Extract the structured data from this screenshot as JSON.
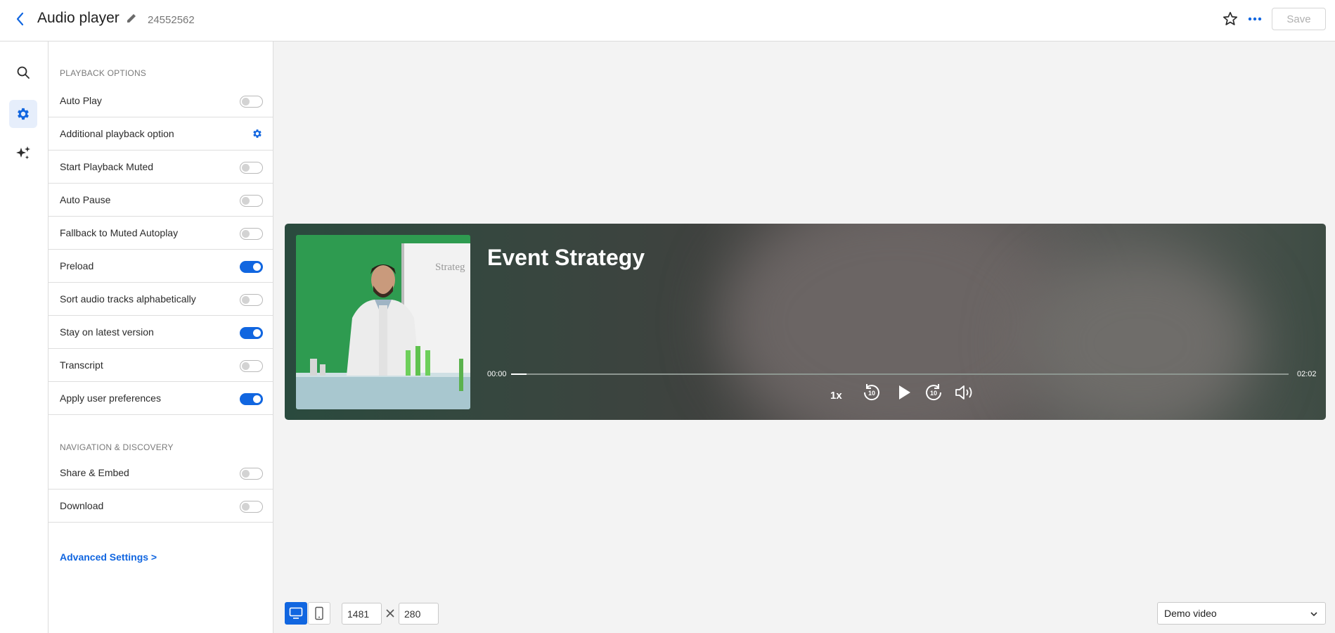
{
  "header": {
    "title": "Audio player",
    "player_id": "24552562",
    "save_label": "Save"
  },
  "rail": {
    "items": [
      "search-icon",
      "gear-icon",
      "sparkles-icon"
    ],
    "active": "gear-icon"
  },
  "panel": {
    "playback_section": "PLAYBACK OPTIONS",
    "playback_options": [
      {
        "label": "Auto Play",
        "control": "toggle",
        "on": false
      },
      {
        "label": "Additional playback option",
        "control": "gear"
      },
      {
        "label": "Start Playback Muted",
        "control": "toggle",
        "on": false
      },
      {
        "label": "Auto Pause",
        "control": "toggle",
        "on": false
      },
      {
        "label": "Fallback to Muted Autoplay",
        "control": "toggle",
        "on": false
      },
      {
        "label": "Preload",
        "control": "toggle",
        "on": true
      },
      {
        "label": "Sort audio tracks alphabetically",
        "control": "toggle",
        "on": false
      },
      {
        "label": "Stay on latest version",
        "control": "toggle",
        "on": true
      },
      {
        "label": "Transcript",
        "control": "toggle",
        "on": false
      },
      {
        "label": "Apply user preferences",
        "control": "toggle",
        "on": true
      }
    ],
    "navigation_section": "NAVIGATION & DISCOVERY",
    "navigation_options": [
      {
        "label": "Share & Embed",
        "control": "toggle",
        "on": false
      },
      {
        "label": "Download",
        "control": "toggle",
        "on": false
      }
    ],
    "advanced_link": "Advanced Settings >"
  },
  "player": {
    "track_title": "Event Strategy",
    "current_time": "00:00",
    "duration": "02:02",
    "progress_fraction": 0.02,
    "speed": "1x",
    "rewind_label": "10",
    "forward_label": "10",
    "whiteboard_text": "Strateg",
    "accent": "#1166e0"
  },
  "bottom": {
    "width_value": "1481",
    "height_value": "280",
    "preview_select": "Demo video"
  }
}
